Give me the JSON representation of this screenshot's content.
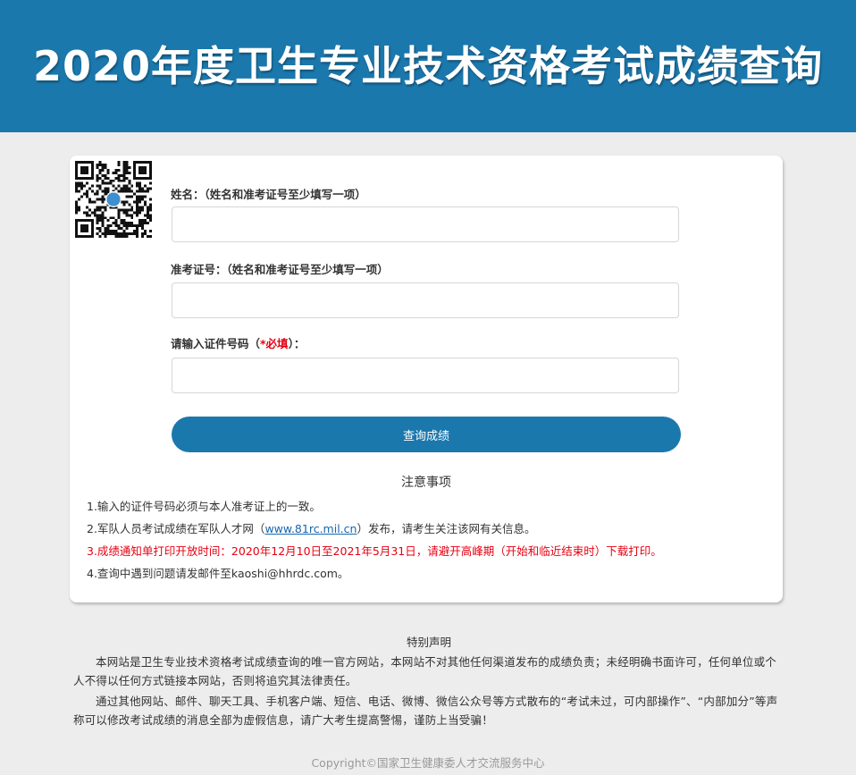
{
  "header": {
    "title": "2020年度卫生专业技术资格考试成绩查询"
  },
  "form": {
    "qr_code_icon": "qr-code-icon",
    "name_label": "姓名：（姓名和准考证号至少填写一项）",
    "exam_no_label": "准考证号：（姓名和准考证号至少填写一项）",
    "id_label_prefix": "请输入证件号码（",
    "id_label_required": "*必填",
    "id_label_suffix": "）：",
    "name_value": "",
    "exam_no_value": "",
    "id_value": "",
    "submit_label": "查询成绩"
  },
  "notice": {
    "title": "注意事项",
    "item1": "1.输入的证件号码必须与本人准考证上的一致。",
    "item2_prefix": "2.军队人员考试成绩在军队人才网（",
    "item2_link": "www.81rc.mil.cn",
    "item2_suffix": "）发布，请考生关注该网有关信息。",
    "item3": "3.成绩通知单打印开放时间：2020年12月10日至2021年5月31日，请避开高峰期（开始和临近结束时）下载打印。",
    "item4": "4.查询中遇到问题请发邮件至kaoshi@hhrdc.com。"
  },
  "statement": {
    "title": "特别声明",
    "para1": "本网站是卫生专业技术资格考试成绩查询的唯一官方网站，本网站不对其他任何渠道发布的成绩负责；未经明确书面许可，任何单位或个人不得以任何方式链接本网站，否则将追究其法律责任。",
    "para2": "通过其他网站、邮件、聊天工具、手机客户端、短信、电话、微博、微信公众号等方式散布的“考试未过，可内部操作”、“内部加分”等声称可以修改考试成绩的消息全部为虚假信息，请广大考生提高警惕，谨防上当受骗！"
  },
  "footer": {
    "copyright": "Copyright©国家卫生健康委人才交流服务中心"
  },
  "colors": {
    "brand": "#1b78ad",
    "required": "#e60012",
    "link": "#1565b0"
  }
}
